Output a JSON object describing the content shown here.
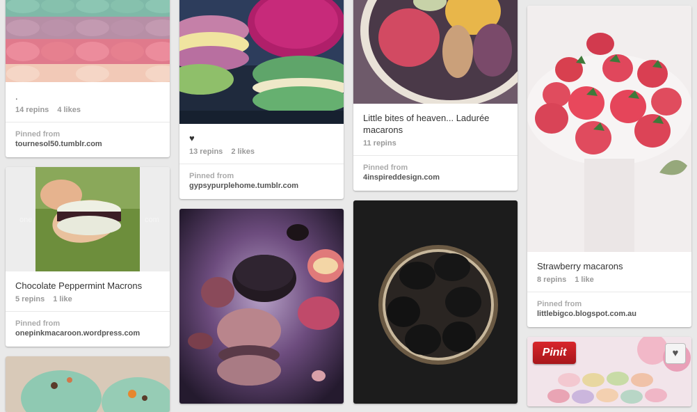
{
  "labels": {
    "pinned_from": "Pinned from"
  },
  "pins": [
    {
      "description": ".",
      "repins": "14 repins",
      "likes": "4 likes",
      "source": "tournesol50.tumblr.com"
    },
    {
      "description": "Chocolate Peppermint Macrons",
      "repins": "5 repins",
      "likes": "1 like",
      "source": "onepinkmacaroon.wordpress.com",
      "watermark_left": "one",
      "watermark_right": "com"
    },
    {
      "description": "♥",
      "repins": "13 repins",
      "likes": "2 likes",
      "source": "gypsypurplehome.tumblr.com"
    },
    {
      "description": "Little bites of heaven... Ladurée macarons",
      "repins": "11 repins",
      "source": "4inspireddesign.com"
    },
    {
      "description": "Strawberry macarons",
      "repins": "8 repins",
      "likes": "1 like",
      "source": "littlebigco.blogspot.com.au"
    }
  ],
  "hover": {
    "pinit_label": "Pinit",
    "like_icon": "heart-icon",
    "like_glyph": "♥"
  },
  "colors": {
    "background": "#e9e9e9",
    "pinit_red": "#cb2027"
  }
}
